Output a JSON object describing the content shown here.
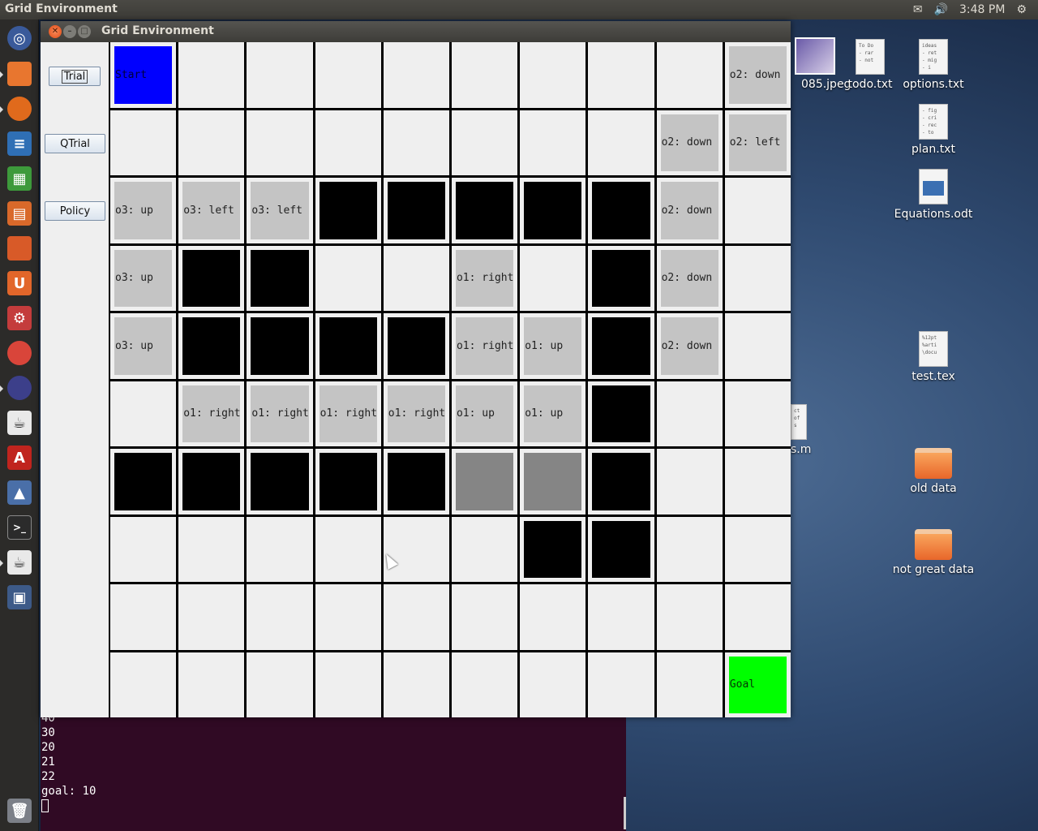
{
  "topbar": {
    "app_title": "Grid Environment",
    "time": "3:48 PM"
  },
  "launcher": {
    "items": [
      "ubuntu-dash-icon",
      "files-icon",
      "firefox-icon",
      "writer-icon",
      "calc-icon",
      "impress-icon",
      "software-center-icon",
      "ubuntu-one-icon",
      "system-settings-icon",
      "chrome-icon",
      "eclipse-icon",
      "java-app-icon",
      "acrobat-icon",
      "matlab-icon",
      "terminal-icon",
      "java-app-icon-2",
      "workspace-switcher-icon",
      "trash-icon"
    ]
  },
  "desktop": {
    "icons": [
      {
        "label": "085.jpeg"
      },
      {
        "label": "todo.txt",
        "preview": "To Do\n- rar\n- not"
      },
      {
        "label": "options.txt",
        "preview": "ideas\n- ret\n- mig\n- i"
      },
      {
        "label": "plan.txt",
        "preview": "- fig\n- cri\n- rec\n- to"
      },
      {
        "label": "Equations.odt"
      },
      {
        "label": "test.tex",
        "preview": "%12pt\n%arti\n\\docu"
      },
      {
        "label": "s.m",
        "preview": "ct\nof\ns"
      },
      {
        "label": "old data"
      },
      {
        "label": "not great data"
      }
    ]
  },
  "window": {
    "title": "Grid Environment",
    "buttons": {
      "trial": "Trial",
      "qtrial": "QTrial",
      "policy": "Policy"
    },
    "grid": {
      "rows": [
        [
          {
            "t": "start",
            "l": "Start"
          },
          {
            "t": "empty",
            "l": ""
          },
          {
            "t": "empty",
            "l": ""
          },
          {
            "t": "empty",
            "l": ""
          },
          {
            "t": "empty",
            "l": ""
          },
          {
            "t": "empty",
            "l": ""
          },
          {
            "t": "empty",
            "l": ""
          },
          {
            "t": "empty",
            "l": ""
          },
          {
            "t": "empty",
            "l": ""
          },
          {
            "t": "policy",
            "l": "o2: down"
          }
        ],
        [
          {
            "t": "empty",
            "l": ""
          },
          {
            "t": "empty",
            "l": ""
          },
          {
            "t": "empty",
            "l": ""
          },
          {
            "t": "empty",
            "l": ""
          },
          {
            "t": "empty",
            "l": ""
          },
          {
            "t": "empty",
            "l": ""
          },
          {
            "t": "empty",
            "l": ""
          },
          {
            "t": "empty",
            "l": ""
          },
          {
            "t": "policy",
            "l": "o2: down"
          },
          {
            "t": "policy",
            "l": "o2: left"
          }
        ],
        [
          {
            "t": "policy",
            "l": "o3: up"
          },
          {
            "t": "policy",
            "l": "o3: left"
          },
          {
            "t": "policy",
            "l": "o3: left"
          },
          {
            "t": "wall",
            "l": ""
          },
          {
            "t": "wall",
            "l": ""
          },
          {
            "t": "wall",
            "l": ""
          },
          {
            "t": "wall",
            "l": ""
          },
          {
            "t": "wall",
            "l": ""
          },
          {
            "t": "policy",
            "l": "o2: down"
          },
          {
            "t": "empty",
            "l": ""
          }
        ],
        [
          {
            "t": "policy",
            "l": "o3: up"
          },
          {
            "t": "wall",
            "l": ""
          },
          {
            "t": "wall",
            "l": ""
          },
          {
            "t": "empty",
            "l": ""
          },
          {
            "t": "empty",
            "l": ""
          },
          {
            "t": "policy",
            "l": "o1: right"
          },
          {
            "t": "empty",
            "l": ""
          },
          {
            "t": "wall",
            "l": ""
          },
          {
            "t": "policy",
            "l": "o2: down"
          },
          {
            "t": "empty",
            "l": ""
          }
        ],
        [
          {
            "t": "policy",
            "l": "o3: up"
          },
          {
            "t": "wall",
            "l": ""
          },
          {
            "t": "wall",
            "l": ""
          },
          {
            "t": "wall",
            "l": ""
          },
          {
            "t": "wall",
            "l": ""
          },
          {
            "t": "policy",
            "l": "o1: right"
          },
          {
            "t": "policy",
            "l": "o1: up"
          },
          {
            "t": "wall",
            "l": ""
          },
          {
            "t": "policy",
            "l": "o2: down"
          },
          {
            "t": "empty",
            "l": ""
          }
        ],
        [
          {
            "t": "empty",
            "l": ""
          },
          {
            "t": "policy",
            "l": "o1: right"
          },
          {
            "t": "policy",
            "l": "o1: right"
          },
          {
            "t": "policy",
            "l": "o1: right"
          },
          {
            "t": "policy",
            "l": "o1: right"
          },
          {
            "t": "policy",
            "l": "o1: up"
          },
          {
            "t": "policy",
            "l": "o1: up"
          },
          {
            "t": "wall",
            "l": ""
          },
          {
            "t": "empty",
            "l": ""
          },
          {
            "t": "empty",
            "l": ""
          }
        ],
        [
          {
            "t": "wall",
            "l": ""
          },
          {
            "t": "wall",
            "l": ""
          },
          {
            "t": "wall",
            "l": ""
          },
          {
            "t": "wall",
            "l": ""
          },
          {
            "t": "wall",
            "l": ""
          },
          {
            "t": "visited",
            "l": ""
          },
          {
            "t": "visited",
            "l": ""
          },
          {
            "t": "wall",
            "l": ""
          },
          {
            "t": "empty",
            "l": ""
          },
          {
            "t": "empty",
            "l": ""
          }
        ],
        [
          {
            "t": "empty",
            "l": ""
          },
          {
            "t": "empty",
            "l": ""
          },
          {
            "t": "empty",
            "l": ""
          },
          {
            "t": "empty",
            "l": ""
          },
          {
            "t": "empty",
            "l": ""
          },
          {
            "t": "empty",
            "l": ""
          },
          {
            "t": "wall",
            "l": ""
          },
          {
            "t": "wall",
            "l": ""
          },
          {
            "t": "empty",
            "l": ""
          },
          {
            "t": "empty",
            "l": ""
          }
        ],
        [
          {
            "t": "empty",
            "l": ""
          },
          {
            "t": "empty",
            "l": ""
          },
          {
            "t": "empty",
            "l": ""
          },
          {
            "t": "empty",
            "l": ""
          },
          {
            "t": "empty",
            "l": ""
          },
          {
            "t": "empty",
            "l": ""
          },
          {
            "t": "empty",
            "l": ""
          },
          {
            "t": "empty",
            "l": ""
          },
          {
            "t": "empty",
            "l": ""
          },
          {
            "t": "empty",
            "l": ""
          }
        ],
        [
          {
            "t": "empty",
            "l": ""
          },
          {
            "t": "empty",
            "l": ""
          },
          {
            "t": "empty",
            "l": ""
          },
          {
            "t": "empty",
            "l": ""
          },
          {
            "t": "empty",
            "l": ""
          },
          {
            "t": "empty",
            "l": ""
          },
          {
            "t": "empty",
            "l": ""
          },
          {
            "t": "empty",
            "l": ""
          },
          {
            "t": "empty",
            "l": ""
          },
          {
            "t": "goal",
            "l": "Goal"
          }
        ]
      ]
    }
  },
  "terminal": {
    "lines": [
      "40",
      "30",
      "20",
      "21",
      "22",
      "goal: 10"
    ]
  },
  "colors": {
    "start": "#0000ff",
    "goal": "#00ff00",
    "wall": "#000000",
    "policy": "#c4c4c4",
    "visited": "#858585",
    "terminal_bg": "#300a24"
  }
}
